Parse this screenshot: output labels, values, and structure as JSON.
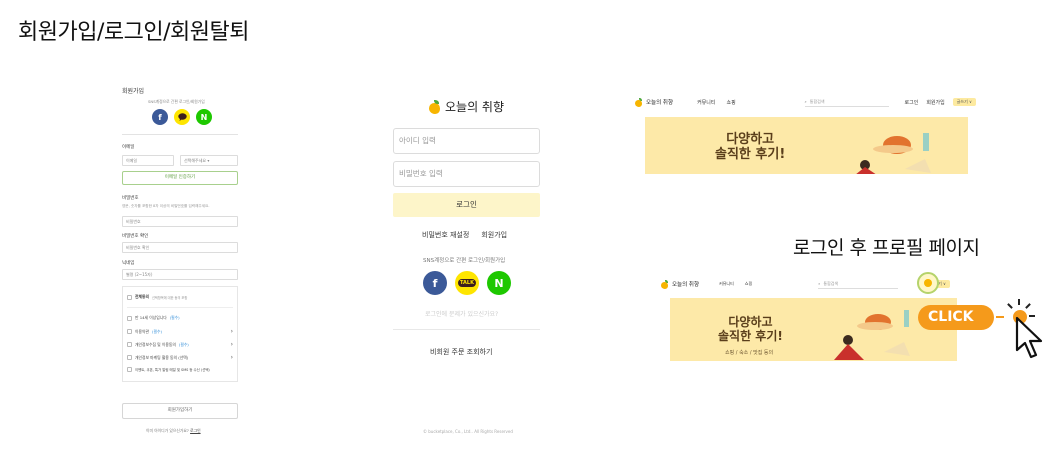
{
  "page_title": "회원가입/로그인/회원탈퇴",
  "signup": {
    "title": "회원가입",
    "sns_hint": "SNS계정으로 간편 로그인/회원가입",
    "sns": [
      "f",
      "",
      "N"
    ],
    "email_label": "이메일",
    "email_local_placeholder": "이메일",
    "email_domain_placeholder": "선택해주세요",
    "email_verify_button": "이메일 인증하기",
    "password_label": "비밀번호",
    "password_help": "영문, 숫자를 포함한 8자 이상의 비밀번호를 입력해주세요.",
    "password_placeholder": "비밀번호",
    "password_confirm_label": "비밀번호 확인",
    "password_confirm_placeholder": "비밀번호 확인",
    "nickname_label": "닉네임",
    "nickname_placeholder": "별명 (2~15자)",
    "agree_all": "전체동의",
    "agree_all_sub": "선택항목에 대한 동의 포함",
    "agree_items": [
      {
        "label": "만 14세 이상입니다",
        "tag": "(필수)",
        "arrow": ""
      },
      {
        "label": "이용약관",
        "tag": "(필수)",
        "arrow": "›"
      },
      {
        "label": "개인정보수집 및 이용동의",
        "tag": "(필수)",
        "arrow": "›"
      },
      {
        "label": "개인정보 마케팅 활용 동의 (선택)",
        "tag": "",
        "arrow": "›"
      },
      {
        "label": "이벤트, 쿠폰, 특가 알림 메일 및 SMS 등 수신 (선택)",
        "tag": "",
        "arrow": ""
      }
    ],
    "submit": "회원가입하기",
    "footer_text": "이미 아이디가 있으신가요?",
    "footer_link": "로그인"
  },
  "login": {
    "brand": "오늘의 취향",
    "id_placeholder": "아이디 입력",
    "pw_placeholder": "비밀번호 입력",
    "login_button": "로그인",
    "reset_pw": "비밀번호 재설정",
    "signup": "회원가입",
    "sns_text": "SNS계정으로 간편 로그인/회원가입",
    "sns": [
      "f",
      "TALK",
      "N"
    ],
    "forgot": "로그인에 문제가 있으신가요?",
    "guest_order": "비회원 주문 조회하기",
    "copyright": "© bucketplace, Co., Ltd.. All Rights Reserved"
  },
  "site_top": {
    "logo": "오늘의 취향",
    "nav": [
      "커뮤니티",
      "쇼핑"
    ],
    "search": "통합검색",
    "right": [
      "로그인",
      "회원가입"
    ],
    "pill": "글쓰기 ∨",
    "banner": [
      "다양하고",
      "솔직한 후기!"
    ]
  },
  "caption_profile": "로그인 후 프로필 페이지",
  "site_bottom": {
    "logo": "오늘의 취향",
    "nav": [
      "커뮤니티",
      "쇼핑"
    ],
    "search": "통합검색",
    "pill": "글쓰기 ∨",
    "banner": [
      "다양하고",
      "솔직한 후기!"
    ],
    "banner_sub": "쇼핑 / 숙소 / 맛집 등의"
  },
  "click_label": "CLICK"
}
